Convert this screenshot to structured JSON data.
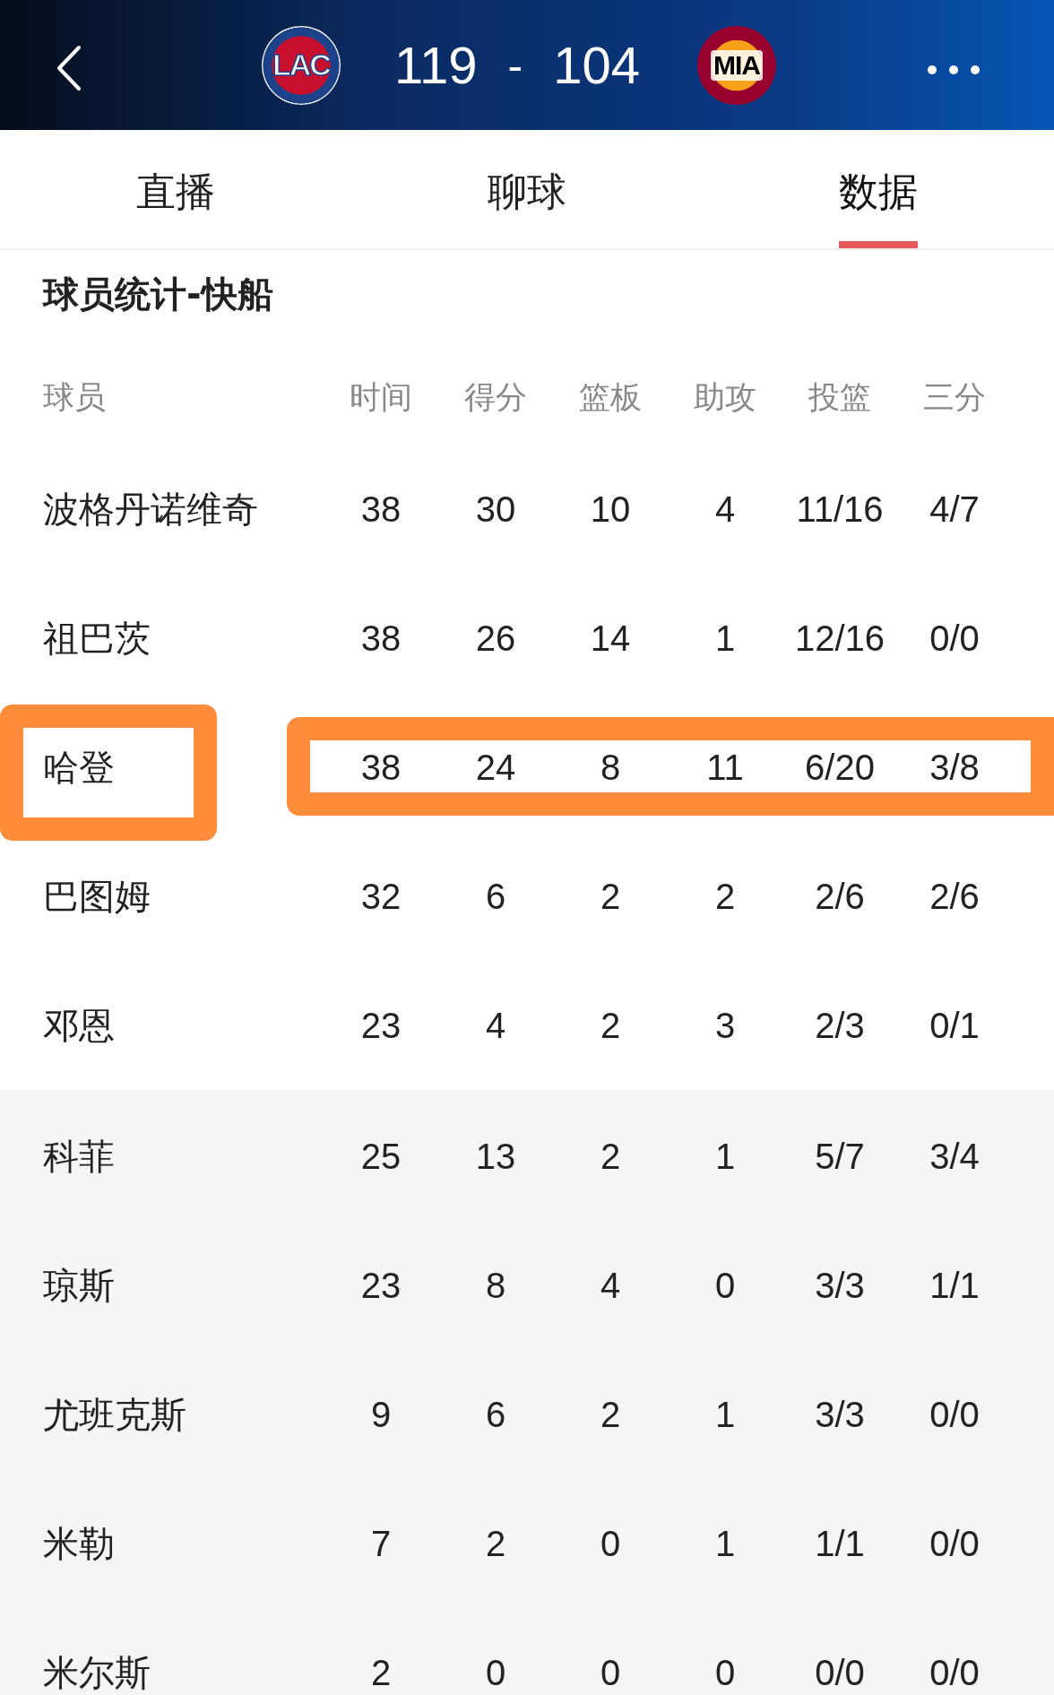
{
  "header": {
    "home": {
      "abbr": "LAC",
      "score": "119"
    },
    "separator": "-",
    "away": {
      "abbr": "MIA",
      "score": "104"
    }
  },
  "tabs": [
    {
      "label": "直播",
      "selected": false
    },
    {
      "label": "聊球",
      "selected": false
    },
    {
      "label": "数据",
      "selected": true
    }
  ],
  "section_title": "球员统计-快船",
  "table": {
    "columns": [
      "球员",
      "时间",
      "得分",
      "篮板",
      "助攻",
      "投篮",
      "三分"
    ],
    "starters": [
      {
        "cells": [
          "波格丹诺维奇",
          "38",
          "30",
          "10",
          "4",
          "11/16",
          "4/7"
        ],
        "highlighted": false
      },
      {
        "cells": [
          "祖巴茨",
          "38",
          "26",
          "14",
          "1",
          "12/16",
          "0/0"
        ],
        "highlighted": false
      },
      {
        "cells": [
          "哈登",
          "38",
          "24",
          "8",
          "11",
          "6/20",
          "3/8"
        ],
        "highlighted": true
      },
      {
        "cells": [
          "巴图姆",
          "32",
          "6",
          "2",
          "2",
          "2/6",
          "2/6"
        ],
        "highlighted": false
      },
      {
        "cells": [
          "邓恩",
          "23",
          "4",
          "2",
          "3",
          "2/3",
          "0/1"
        ],
        "highlighted": false
      }
    ],
    "bench": [
      {
        "cells": [
          "科菲",
          "25",
          "13",
          "2",
          "1",
          "5/7",
          "3/4"
        ],
        "highlighted": false
      },
      {
        "cells": [
          "琼斯",
          "23",
          "8",
          "4",
          "0",
          "3/3",
          "1/1"
        ],
        "highlighted": false
      },
      {
        "cells": [
          "尤班克斯",
          "9",
          "6",
          "2",
          "1",
          "3/3",
          "0/0"
        ],
        "highlighted": false
      },
      {
        "cells": [
          "米勒",
          "7",
          "2",
          "0",
          "1",
          "1/1",
          "0/0"
        ],
        "highlighted": false
      },
      {
        "cells": [
          "米尔斯",
          "2",
          "0",
          "0",
          "0",
          "0/0",
          "0/0"
        ],
        "highlighted": false
      }
    ]
  }
}
